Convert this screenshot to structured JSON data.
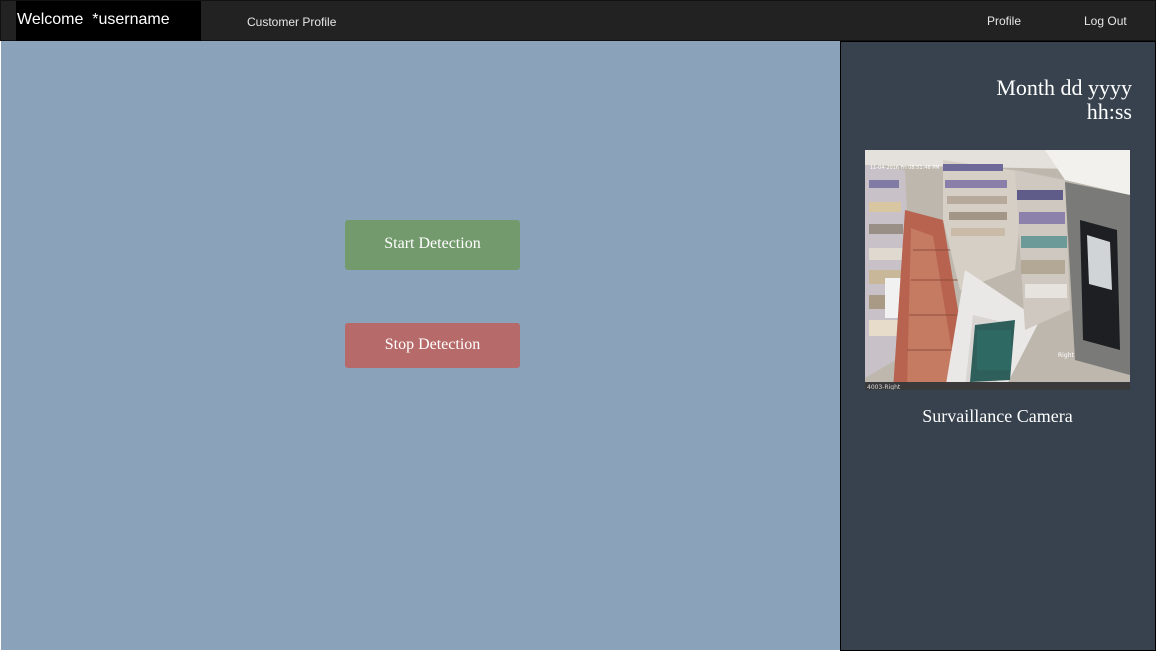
{
  "navbar": {
    "brand": "Welcome  *username",
    "customer_profile": "Customer Profile",
    "profile": "Profile",
    "logout": "Log Out"
  },
  "main": {
    "start_label": "Start Detection",
    "stop_label": "Stop Detection"
  },
  "sidebar": {
    "date": "Month dd yyyy",
    "time": "hh:ss",
    "camera_caption": "Survaillance Camera",
    "camera_overlay_timestamp": "11-04-2016 Fri 08:51:46 PM",
    "camera_overlay_right": "Right",
    "camera_overlay_id": "4003-Right"
  },
  "colors": {
    "navbar": "#222222",
    "main_background": "#8aa2ba",
    "sidebar_background": "#37424e",
    "start_button": "#729a6c",
    "stop_button": "#b76a6a"
  }
}
